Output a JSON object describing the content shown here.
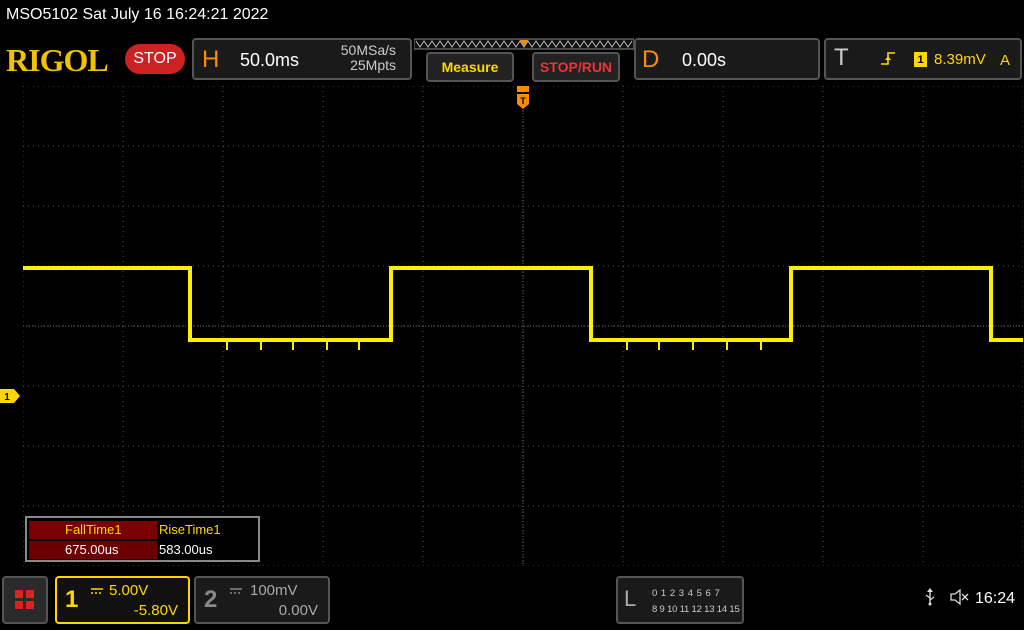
{
  "window": {
    "title": "MSO5102  Sat July 16 16:24:21 2022"
  },
  "brand": {
    "logo": "RIGOL",
    "run_state": "STOP"
  },
  "horizontal": {
    "letter": "H",
    "time_base": "50.0ms",
    "sample_rate": "50MSa/s",
    "memory_depth": "25Mpts"
  },
  "toolbar": {
    "measure_label": "Measure",
    "stop_run_label": "STOP/RUN"
  },
  "delay": {
    "letter": "D",
    "value": "0.00s"
  },
  "trigger": {
    "letter": "T",
    "source": "1",
    "level": "8.39mV",
    "mode": "A",
    "edge_icon": "rising-edge-icon"
  },
  "scope": {
    "channel1_marker": "1",
    "trace_color": "#ffee00"
  },
  "measurements": [
    {
      "name": "FallTime1",
      "value": "675.00us"
    },
    {
      "name": "RiseTime1",
      "value": "583.00us"
    }
  ],
  "channels": [
    {
      "num": "1",
      "scale": "5.00V",
      "offset": "-5.80V",
      "color": "#ffd700"
    },
    {
      "num": "2",
      "scale": "100mV",
      "offset": "0.00V",
      "color": "#888888"
    }
  ],
  "logic_analyzer": {
    "letter": "L",
    "row1": "0 1 2 3  4 5 6 7",
    "row2": "8 9 10 11 12 13 14 15"
  },
  "status": {
    "time": "16:24",
    "usb_icon": "usb-icon",
    "speaker_icon": "speaker-muted-icon"
  }
}
